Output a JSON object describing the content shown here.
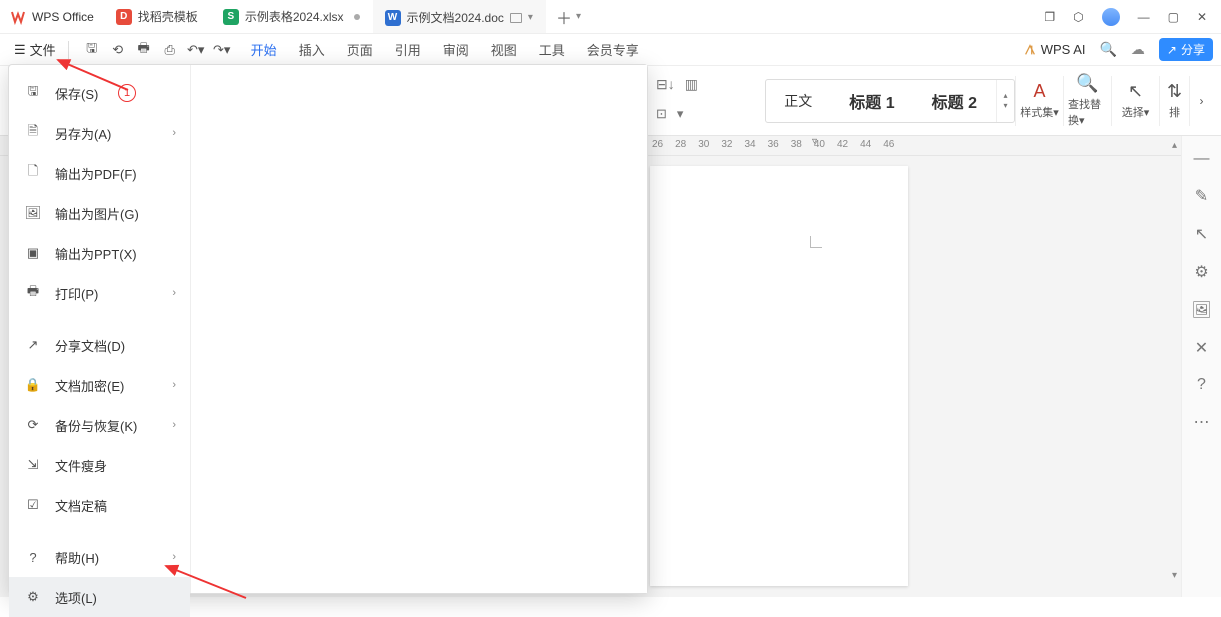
{
  "app": {
    "name": "WPS Office"
  },
  "title_tabs": [
    {
      "label": "找稻壳模板",
      "icon_bg": "#e74c3c",
      "icon_text": "D"
    },
    {
      "label": "示例表格2024.xlsx",
      "icon_bg": "#1fa463",
      "icon_text": "S",
      "dirty": true
    },
    {
      "label": "示例文档2024.doc",
      "icon_bg": "#2f6fd0",
      "icon_text": "W",
      "active": true
    }
  ],
  "toolbar": {
    "file_label": "文件",
    "main_tabs": [
      "开始",
      "插入",
      "页面",
      "引用",
      "审阅",
      "视图",
      "工具",
      "会员专享"
    ],
    "active_main_tab": "开始",
    "ai_label": "WPS AI",
    "share_label": "分享"
  },
  "ribbon": {
    "styles": {
      "normal": "正文",
      "h1": "标题 1",
      "h2": "标题 2"
    },
    "styleset": "样式集",
    "find": "查找替换",
    "select": "选择",
    "arrange": "排"
  },
  "ruler_numbers": [
    "26",
    "28",
    "30",
    "32",
    "34",
    "36",
    "38",
    "40",
    "42",
    "44",
    "46"
  ],
  "file_menu": {
    "save": "保存(S)",
    "save_as": "另存为(A)",
    "export_pdf": "输出为PDF(F)",
    "export_img": "输出为图片(G)",
    "export_ppt": "输出为PPT(X)",
    "print": "打印(P)",
    "share_doc": "分享文档(D)",
    "encrypt": "文档加密(E)",
    "backup": "备份与恢复(K)",
    "slim": "文件瘦身",
    "finalize": "文档定稿",
    "help": "帮助(H)",
    "options": "选项(L)"
  },
  "annotations": {
    "num1": "1"
  }
}
